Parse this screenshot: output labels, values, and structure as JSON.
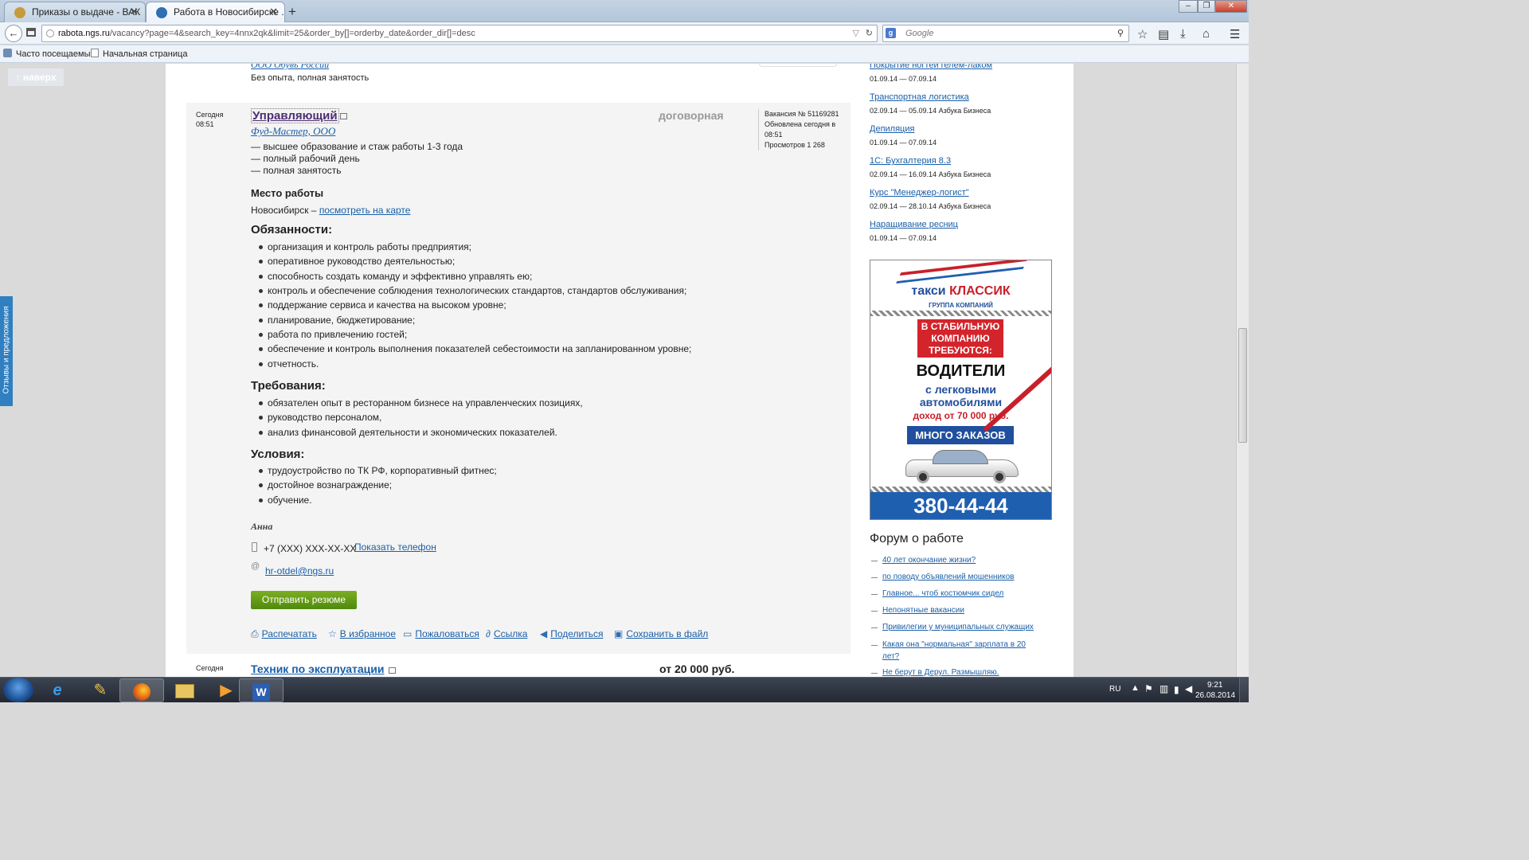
{
  "browser": {
    "tabs": [
      {
        "label": "Приказы о выдаче - ВАК"
      },
      {
        "label": "Работа в Новосибирске ..."
      }
    ],
    "new_tab": "+",
    "url_host": "rabota.ngs.ru",
    "url_path": "/vacancy?page=4&search_key=4nnx2qk&limit=25&order_by[]=orderby_date&order_dir[]=desc",
    "search_placeholder": "Google",
    "bookmarks": [
      {
        "label": "Часто посещаемые"
      },
      {
        "label": "Начальная страница"
      }
    ]
  },
  "page": {
    "up_button": "↑ наверх",
    "feedback_tab": "Отзывы и предложения",
    "prev_vacancy": {
      "company": "ООО Обувь России",
      "conditions": "Без опыта, полная занятость"
    },
    "vacancy": {
      "date": "Сегодня",
      "time": "08:51",
      "title": "Управляющий",
      "company": "Фуд-Мастер, ООО",
      "salary": "договорная",
      "meta": {
        "number": "Вакансия № 51169281",
        "updated1": "Обновлена сегодня в",
        "updated2": "08:51",
        "views": "Просмотров 1 268"
      },
      "summary": [
        "— высшее образование и стаж работы 1-3 года",
        "— полный рабочий день",
        "— полная занятость"
      ],
      "place_heading": "Место работы",
      "place_city": "Новосибирск –",
      "place_map_link": "посмотреть на карте",
      "duties_heading": "Обязанности:",
      "duties": [
        "организация и контроль работы предприятия;",
        "оперативное руководство деятельностью;",
        "способность создать команду и эффективно управлять ею;",
        "контроль и обеспечение соблюдения технологических стандартов, стандартов обслуживания;",
        "поддержание сервиса и качества на высоком уровне;",
        "планирование, бюджетирование;",
        "работа по привлечению гостей;",
        "обеспечение и контроль выполнения показателей себестоимости на запланированном уровне;",
        "отчетность."
      ],
      "req_heading": "Требования:",
      "requirements": [
        "обязателен опыт в ресторанном бизнесе на управленческих позициях,",
        "руководство персоналом,",
        "анализ финансовой деятельности и экономических показателей."
      ],
      "cond_heading": "Условия:",
      "conditions": [
        "трудоустройство по ТК РФ, корпоративный фитнес;",
        "достойное вознаграждение;",
        "обучение."
      ],
      "contact_name": "Анна",
      "phone": "+7 (XXX) XXX-XX-XX",
      "show_phone": "Показать телефон",
      "email": "hr-otdel@ngs.ru",
      "send_button": "Отправить резюме",
      "actions": [
        {
          "label": "Распечатать",
          "icon": "print-icon"
        },
        {
          "label": "В избранное",
          "icon": "star-icon"
        },
        {
          "label": "Пожаловаться",
          "icon": "complain-icon"
        },
        {
          "label": "Ссылка",
          "icon": "link-icon"
        },
        {
          "label": "Поделиться",
          "icon": "share-icon"
        },
        {
          "label": "Сохранить в файл",
          "icon": "save-icon"
        }
      ]
    },
    "next_vacancy": {
      "date": "Сегодня",
      "title": "Техник по эксплуатации",
      "salary": "от 20 000 руб."
    },
    "sidebar": {
      "courses": [
        {
          "title": "Покрытие ногтей гелем-лаком",
          "dates": "01.09.14 — 07.09.14"
        },
        {
          "title": "Транспортная логистика",
          "dates": "02.09.14 — 05.09.14 Азбука Бизнеса"
        },
        {
          "title": "Депиляция",
          "dates": "01.09.14 — 07.09.14"
        },
        {
          "title": "1С: Бухгалтерия 8.3",
          "dates": "02.09.14 — 16.09.14 Азбука Бизнеса"
        },
        {
          "title": "Курс \"Менеджер-логист\"",
          "dates": "02.09.14 — 28.10.14 Азбука Бизнеса"
        },
        {
          "title": "Наращивание ресниц",
          "dates": "01.09.14 — 07.09.14"
        }
      ],
      "ad": {
        "brand1": "такси",
        "brand2": "КЛАССИК",
        "group": "ГРУППА КОМПАНИЙ",
        "red1": "В СТАБИЛЬНУЮ",
        "red2": "КОМПАНИЮ",
        "red3": "ТРЕБУЮТСЯ:",
        "drivers": "ВОДИТЕЛИ",
        "l1": "с легковыми",
        "l2": "автомобилями",
        "income": "доход от 70 000 руб.",
        "orders": "МНОГО ЗАКАЗОВ",
        "phone": "380-44-44"
      },
      "forum_title": "Форум о работе",
      "forum": [
        "40 лет окончание жизни?",
        "по поводу объявлений мошенников",
        "Главное... чтоб костюмчик сидел",
        "Непонятные вакансии",
        "Привилегии у муниципальных служащих",
        "Какая она \"нормальная\" зарплата в 20",
        "лет?",
        "Не берут в Дерул. Размышляю."
      ]
    }
  },
  "taskbar": {
    "lang": "RU",
    "time": "9:21",
    "date": "26.08.2014"
  }
}
